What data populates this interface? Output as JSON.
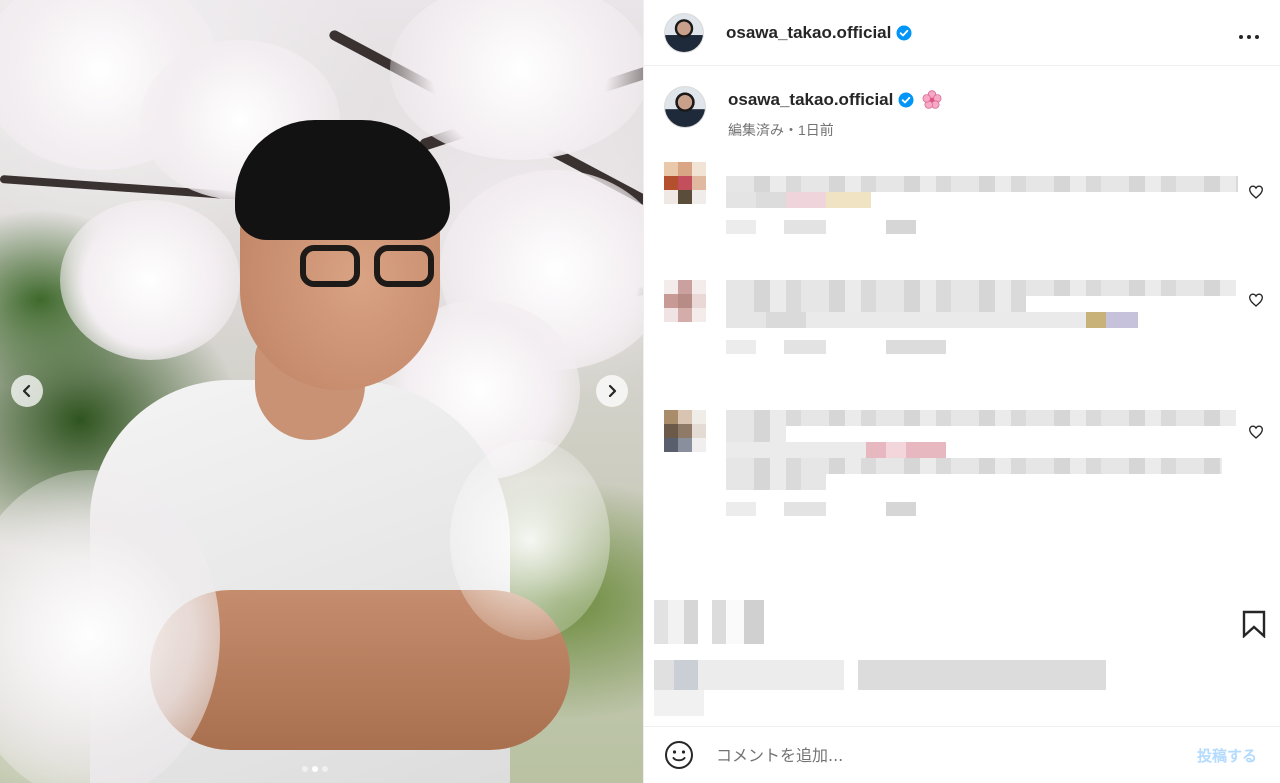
{
  "header": {
    "username": "osawa_takao.official",
    "more_icon": "more-horizontal-icon"
  },
  "caption": {
    "username": "osawa_takao.official",
    "meta": "編集済み・1日前"
  },
  "composer": {
    "placeholder": "コメントを追加...",
    "post_label": "投稿する"
  },
  "carousel": {
    "slide_count": 3,
    "active_index": 1
  },
  "colors": {
    "verified": "#0095f6",
    "text": "#262626",
    "muted": "#737373",
    "post_disabled": "#b3dbff"
  }
}
